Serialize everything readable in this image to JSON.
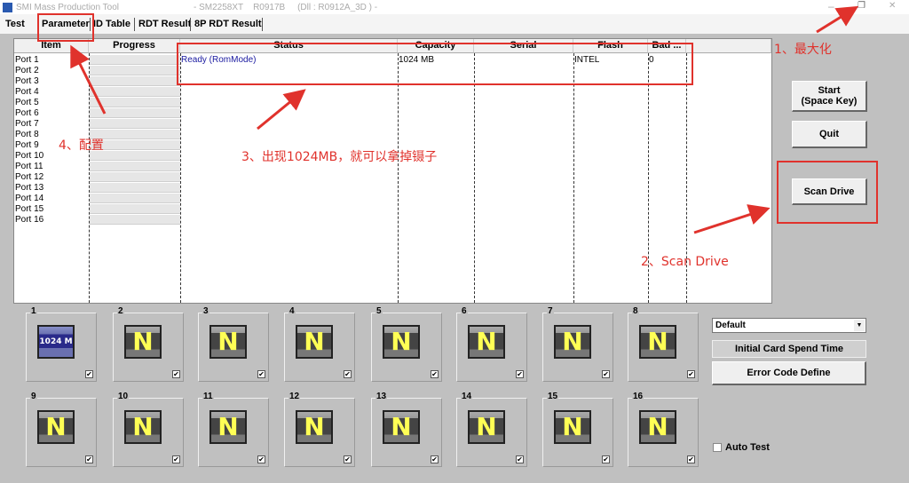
{
  "window": {
    "app_title": "SMI Mass Production Tool",
    "subtitle": "- SM2258XT    R0917B     (Dll : R0912A_3D ) -",
    "minimize": "–",
    "restore": "❐",
    "close": "✕"
  },
  "tabs": [
    "Test",
    "Parameter",
    "ID Table",
    "RDT Result",
    "8P RDT Result"
  ],
  "table": {
    "columns": [
      "Item",
      "Progress",
      "Status",
      "Capacity",
      "Serial",
      "Flash",
      "Bad ..."
    ],
    "rows": [
      {
        "item": "Port 1",
        "status": "Ready (RomMode)",
        "capacity": "1024 MB",
        "serial": "",
        "flash": "INTEL",
        "bad": "0"
      },
      {
        "item": "Port 2"
      },
      {
        "item": "Port 3"
      },
      {
        "item": "Port 4"
      },
      {
        "item": "Port 5"
      },
      {
        "item": "Port 6"
      },
      {
        "item": "Port 7"
      },
      {
        "item": "Port 8"
      },
      {
        "item": "Port 9"
      },
      {
        "item": "Port 10"
      },
      {
        "item": "Port 11"
      },
      {
        "item": "Port 12"
      },
      {
        "item": "Port 13"
      },
      {
        "item": "Port 14"
      },
      {
        "item": "Port 15"
      },
      {
        "item": "Port 16"
      }
    ]
  },
  "buttons": {
    "start": "Start\n(Space Key)",
    "quit": "Quit",
    "scan": "Scan Drive",
    "init_time": "Initial Card Spend Time",
    "error_code": "Error Code Define"
  },
  "select": {
    "value": "Default"
  },
  "auto_test": {
    "label": "Auto Test",
    "checked": false
  },
  "ports": [
    {
      "n": "1",
      "icon": "1024 M",
      "checked": true
    },
    {
      "n": "2",
      "icon": "N",
      "checked": true
    },
    {
      "n": "3",
      "icon": "N",
      "checked": true
    },
    {
      "n": "4",
      "icon": "N",
      "checked": true
    },
    {
      "n": "5",
      "icon": "N",
      "checked": true
    },
    {
      "n": "6",
      "icon": "N",
      "checked": true
    },
    {
      "n": "7",
      "icon": "N",
      "checked": true
    },
    {
      "n": "8",
      "icon": "N",
      "checked": true
    },
    {
      "n": "9",
      "icon": "N",
      "checked": true
    },
    {
      "n": "10",
      "icon": "N",
      "checked": true
    },
    {
      "n": "11",
      "icon": "N",
      "checked": true
    },
    {
      "n": "12",
      "icon": "N",
      "checked": true
    },
    {
      "n": "13",
      "icon": "N",
      "checked": true
    },
    {
      "n": "14",
      "icon": "N",
      "checked": true
    },
    {
      "n": "15",
      "icon": "N",
      "checked": true
    },
    {
      "n": "16",
      "icon": "N",
      "checked": true
    }
  ],
  "annotations": {
    "a1": "1、最大化",
    "a2": "2、Scan Drive",
    "a3": "3、出现1024MB，就可以拿掉镊子",
    "a4": "4、配置"
  },
  "colors": {
    "annotation": "#e0322c",
    "status_text": "#1a1aa0",
    "background": "#c0c0c0"
  }
}
